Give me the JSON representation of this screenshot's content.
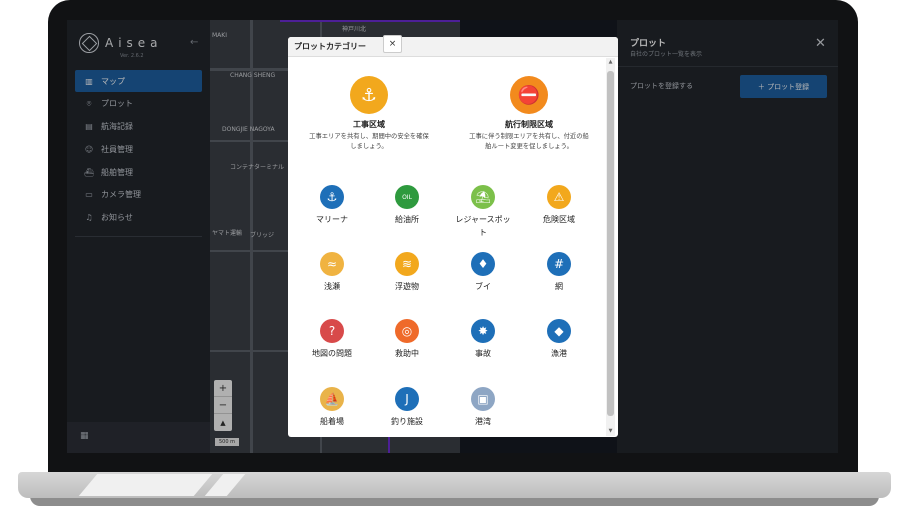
{
  "app": {
    "logo_text": "Aisea",
    "version": "Ver. 2.6.2",
    "collapse_glyph": "←"
  },
  "sidebar": {
    "items": [
      {
        "label": "マップ",
        "icon": "map-icon",
        "glyph": "▥",
        "active": true
      },
      {
        "label": "プロット",
        "icon": "pin-icon",
        "glyph": "⌾",
        "active": false
      },
      {
        "label": "航海記録",
        "icon": "film-icon",
        "glyph": "▤",
        "active": false
      },
      {
        "label": "社員管理",
        "icon": "users-icon",
        "glyph": "☺",
        "active": false
      },
      {
        "label": "船舶管理",
        "icon": "ship-icon",
        "glyph": "⛴",
        "active": false
      },
      {
        "label": "カメラ管理",
        "icon": "camera-icon",
        "glyph": "▭",
        "active": false
      },
      {
        "label": "お知らせ",
        "icon": "bell-icon",
        "glyph": "♫",
        "active": false
      }
    ],
    "bottom_icon": "building-icon",
    "bottom_glyph": "▦"
  },
  "map": {
    "labels": [
      "MAKI",
      "CHANG SHENG",
      "DONGJIE NAGOYA",
      "コンテナターミナル",
      "ヤマト運輸",
      "ブリッジ",
      "神戸川北"
    ],
    "zoom_in": "+",
    "zoom_out": "−",
    "compass": "▲",
    "scale": "500 m"
  },
  "panel": {
    "title": "プロット",
    "subtitle": "自社のプロット一覧を表示",
    "close": "✕",
    "register_label": "プロットを登録する",
    "register_button": "＋ プロット登録"
  },
  "modal": {
    "title": "プロットカテゴリー",
    "close": "×",
    "scroll_up": "▲",
    "scroll_down": "▼",
    "featured": [
      {
        "title": "工事区域",
        "desc": "工事エリアを共有し、期間中の安全を確保しましょう。",
        "icon": "crane-hook-icon",
        "glyph": "⚓",
        "color": "#f2a81d"
      },
      {
        "title": "航行制限区域",
        "desc": "工事に伴う制限エリアを共有し、付近の船舶ルート変更を促しましょう。",
        "icon": "no-ship-icon",
        "glyph": "⛔",
        "color": "#f28a1d"
      }
    ],
    "categories": [
      {
        "label": "マリーナ",
        "icon": "anchor-icon",
        "glyph": "⚓",
        "color": "#1e6fb8"
      },
      {
        "label": "給油所",
        "icon": "oil-icon",
        "glyph": "OIL",
        "color": "#2e9a3e"
      },
      {
        "label": "レジャースポット",
        "icon": "leisure-icon",
        "glyph": "⛱",
        "color": "#7cc04a"
      },
      {
        "label": "危険区域",
        "icon": "warning-icon",
        "glyph": "⚠",
        "color": "#f2a81d"
      },
      {
        "label": "浅瀬",
        "icon": "shallow-icon",
        "glyph": "≈",
        "color": "#f0b341"
      },
      {
        "label": "浮遊物",
        "icon": "debris-icon",
        "glyph": "≋",
        "color": "#f2a81d"
      },
      {
        "label": "ブイ",
        "icon": "buoy-icon",
        "glyph": "♦",
        "color": "#1e6fb8"
      },
      {
        "label": "網",
        "icon": "net-icon",
        "glyph": "#",
        "color": "#1e6fb8"
      },
      {
        "label": "地図の問題",
        "icon": "map-issue-icon",
        "glyph": "?",
        "color": "#d84a4a"
      },
      {
        "label": "救助中",
        "icon": "lifebuoy-icon",
        "glyph": "◎",
        "color": "#ef6a2a"
      },
      {
        "label": "事故",
        "icon": "accident-icon",
        "glyph": "✸",
        "color": "#1e6fb8"
      },
      {
        "label": "漁港",
        "icon": "fishing-port-icon",
        "glyph": "◆",
        "color": "#1e6fb8"
      },
      {
        "label": "船着場",
        "icon": "pier-icon",
        "glyph": "⛵",
        "color": "#e9b34a"
      },
      {
        "label": "釣り施設",
        "icon": "fishing-hook-icon",
        "glyph": "J",
        "color": "#1e6fb8"
      },
      {
        "label": "港湾",
        "icon": "harbor-icon",
        "glyph": "▣",
        "color": "#8ea6c4"
      }
    ]
  }
}
